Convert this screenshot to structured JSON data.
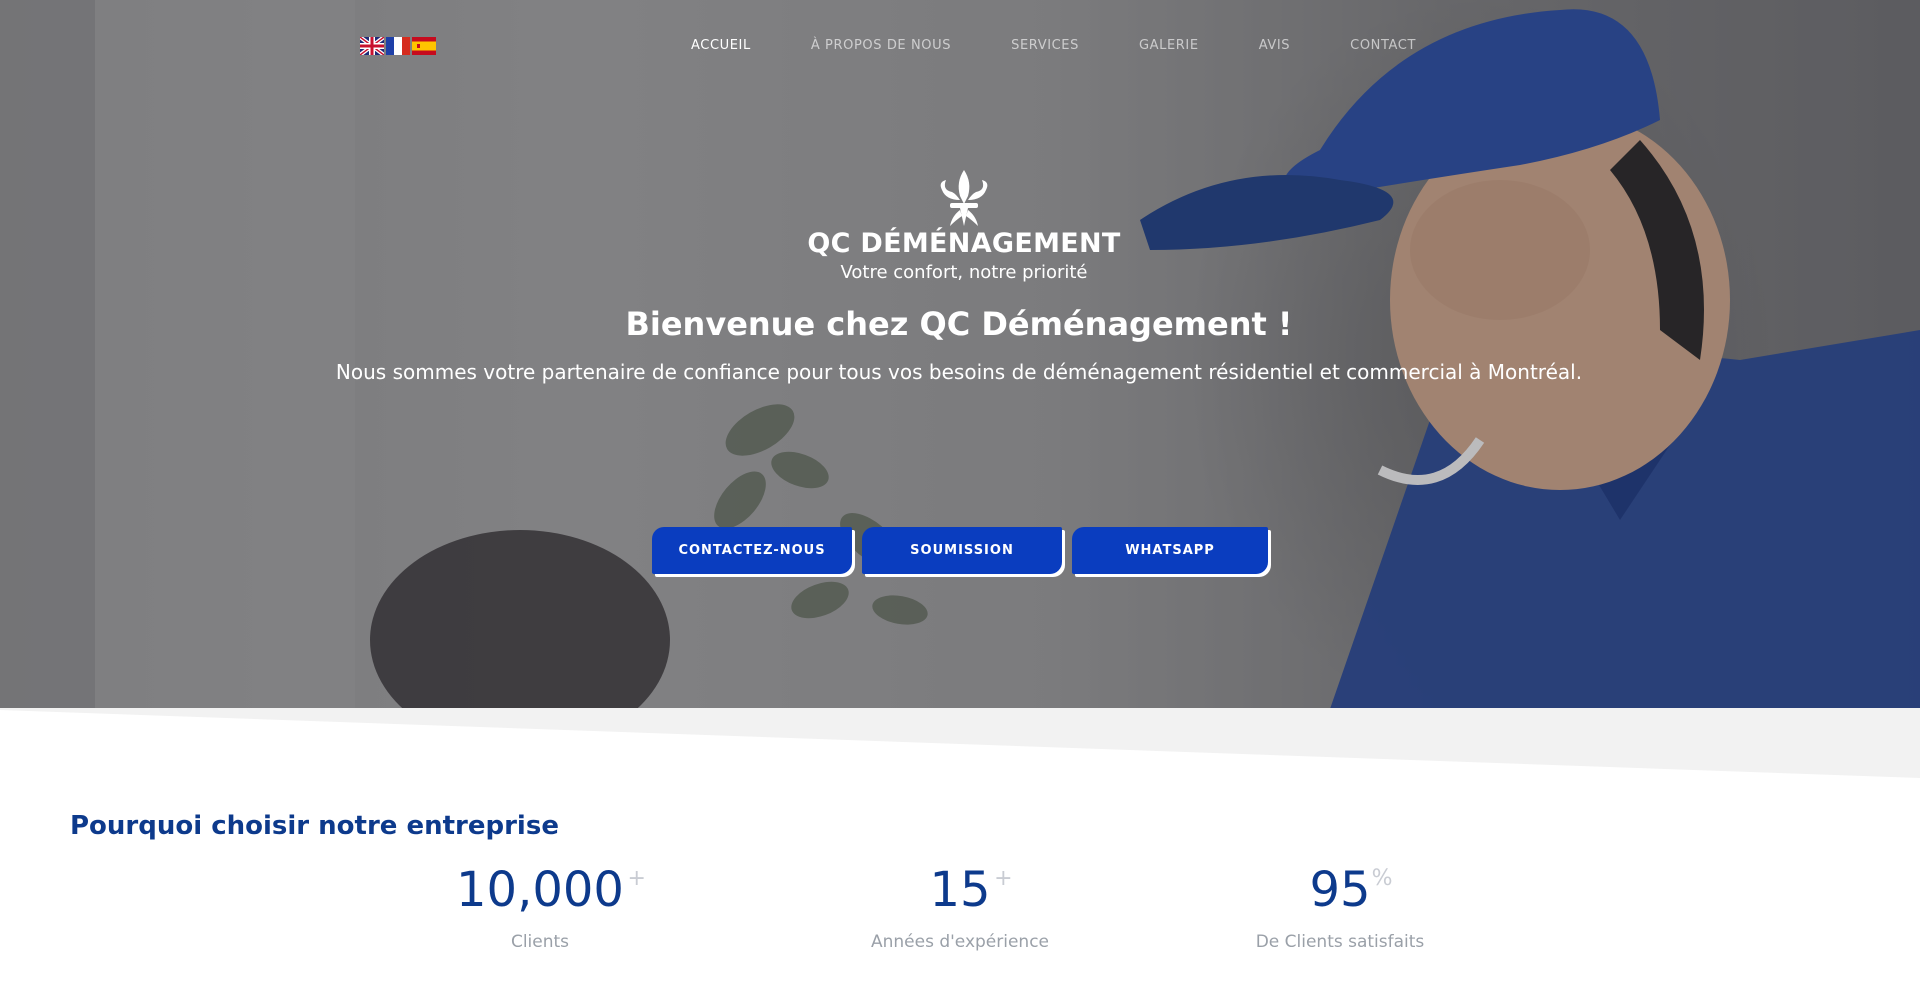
{
  "languages": [
    {
      "code": "en",
      "icon": "uk-flag-icon"
    },
    {
      "code": "fr",
      "icon": "france-flag-icon"
    },
    {
      "code": "es",
      "icon": "spain-flag-icon"
    }
  ],
  "nav": {
    "items": [
      {
        "label": "ACCUEIL",
        "active": true
      },
      {
        "label": "À PROPOS DE NOUS",
        "active": false
      },
      {
        "label": "SERVICES",
        "active": false
      },
      {
        "label": "GALERIE",
        "active": false
      },
      {
        "label": "AVIS",
        "active": false
      },
      {
        "label": "CONTACT",
        "active": false
      }
    ]
  },
  "hero": {
    "logo_icon": "fleur-de-lis-icon",
    "brand": "QC DÉMÉNAGEMENT",
    "tagline": "Votre confort, notre priorité",
    "welcome": "Bienvenue chez QC Déménagement !",
    "intro": "Nous sommes votre partenaire de confiance pour tous vos besoins de déménagement résidentiel et commercial à Montréal.",
    "buttons": {
      "contact": "CONTACTEZ-NOUS",
      "quote": "SOUMISSION",
      "whatsapp": "WHATSAPP"
    }
  },
  "why": {
    "title": "Pourquoi choisir notre entreprise",
    "stats": [
      {
        "value": "10,000",
        "suffix": "+",
        "label": "Clients"
      },
      {
        "value": "15",
        "suffix": "+",
        "label": "Années d'expérience"
      },
      {
        "value": "95",
        "suffix": "%",
        "label": "De Clients satisfaits"
      }
    ]
  },
  "colors": {
    "primary": "#0a3dbf",
    "heading": "#0d3a8c",
    "muted": "#9aa0a8"
  }
}
